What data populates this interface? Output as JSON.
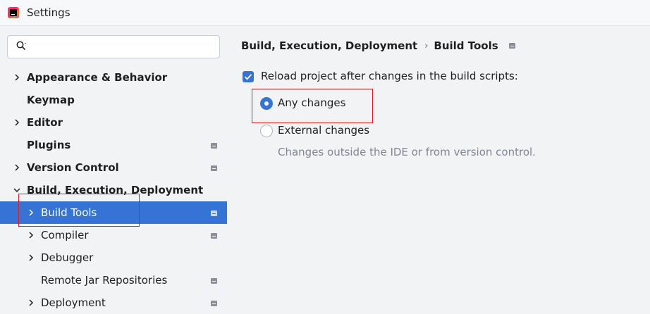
{
  "window": {
    "title": "Settings"
  },
  "search": {
    "placeholder": ""
  },
  "sidebar": {
    "items": [
      {
        "label": "Appearance & Behavior",
        "expandable": true,
        "expanded": false,
        "bold": true,
        "project_icon": false
      },
      {
        "label": "Keymap",
        "expandable": false,
        "bold": true,
        "project_icon": false
      },
      {
        "label": "Editor",
        "expandable": true,
        "expanded": false,
        "bold": true,
        "project_icon": false
      },
      {
        "label": "Plugins",
        "expandable": false,
        "bold": true,
        "project_icon": true
      },
      {
        "label": "Version Control",
        "expandable": true,
        "expanded": false,
        "bold": true,
        "project_icon": true
      },
      {
        "label": "Build, Execution, Deployment",
        "expandable": true,
        "expanded": true,
        "bold": true,
        "project_icon": false
      },
      {
        "label": "Build Tools",
        "expandable": true,
        "expanded": false,
        "bold": false,
        "project_icon": true,
        "selected": true
      },
      {
        "label": "Compiler",
        "expandable": true,
        "expanded": false,
        "bold": false,
        "project_icon": true
      },
      {
        "label": "Debugger",
        "expandable": true,
        "expanded": false,
        "bold": false,
        "project_icon": false
      },
      {
        "label": "Remote Jar Repositories",
        "expandable": false,
        "bold": false,
        "project_icon": true
      },
      {
        "label": "Deployment",
        "expandable": true,
        "expanded": false,
        "bold": false,
        "project_icon": true
      }
    ]
  },
  "breadcrumb": {
    "parent": "Build, Execution, Deployment",
    "separator": "›",
    "current": "Build Tools"
  },
  "settings": {
    "reload_checkbox": {
      "label": "Reload project after changes in the build scripts:",
      "checked": true
    },
    "options": [
      {
        "label": "Any changes",
        "selected": true
      },
      {
        "label": "External changes",
        "selected": false
      }
    ],
    "hint": "Changes outside the IDE or from version control."
  },
  "colors": {
    "accent": "#3574d4",
    "highlight_box": "#e01b24",
    "background": "#f2f3f5"
  }
}
